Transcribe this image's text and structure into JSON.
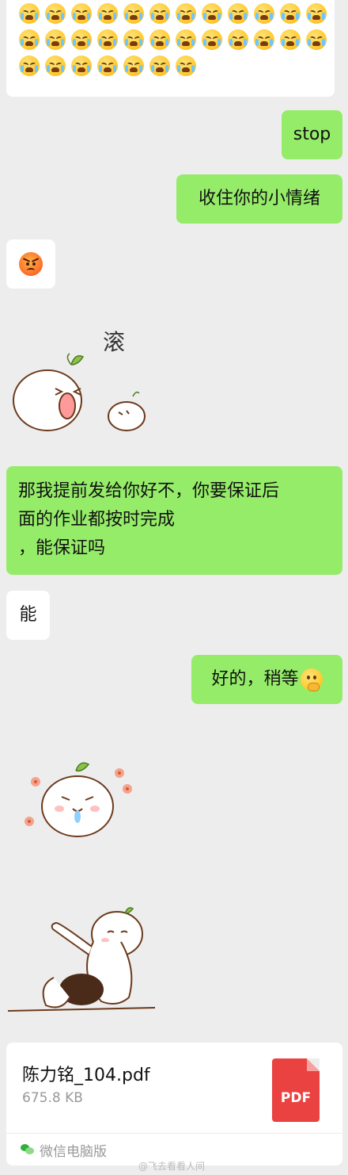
{
  "messages": {
    "cry_block": {
      "rows": [
        12,
        12,
        7
      ]
    },
    "stop": "stop",
    "calm_down": "收住你的小情绪",
    "roll_text": "滚",
    "negotiate": [
      "那我提前发给你好不，你要保证后",
      "面的作业都按时完成",
      "，能保证吗"
    ],
    "can": "能",
    "ok": "好的，稍等"
  },
  "file": {
    "name": "陈力铭_104.pdf",
    "size": "675.8 KB",
    "type_label": "PDF",
    "source": "微信电脑版"
  },
  "watermark": "@飞去看看人间",
  "colors": {
    "sent": "#95ec69",
    "received": "#ffffff",
    "background": "#ededed",
    "pdf": "#e94241"
  }
}
